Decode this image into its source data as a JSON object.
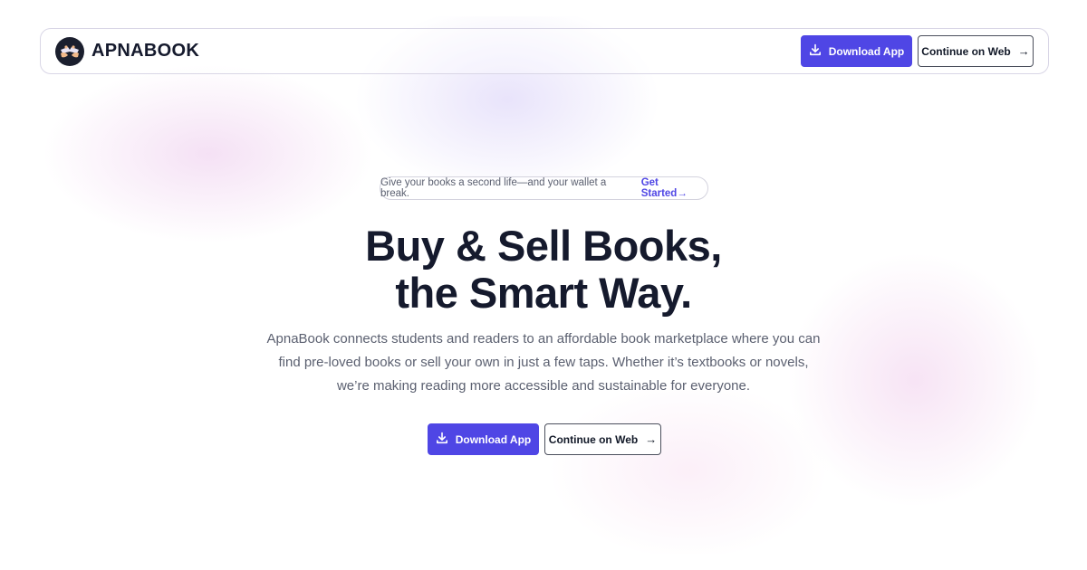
{
  "brand": {
    "name": "APNABOOK"
  },
  "nav": {
    "download_label": "Download App",
    "web_label": "Continue on Web",
    "web_arrow": "→"
  },
  "hero": {
    "tagline": "Give your books a second life—and your wallet a break.",
    "tagline_link": "Get Started→",
    "headline_line1": "Buy & Sell Books,",
    "headline_line2": "the Smart Way.",
    "description": "ApnaBook connects students and readers to an affordable book marketplace where you can find pre-loved books or sell your own in just a few taps. Whether it’s textbooks or novels, we’re making reading more accessible and sustainable for everyone.",
    "download_label": "Download App",
    "web_label": "Continue on Web",
    "web_arrow": "→"
  },
  "colors": {
    "accent": "#4f46e5",
    "text_dark": "#151a2d",
    "text_muted": "#5b6070"
  },
  "icons": {
    "logo": "hands-book-icon",
    "download": "download-icon"
  }
}
